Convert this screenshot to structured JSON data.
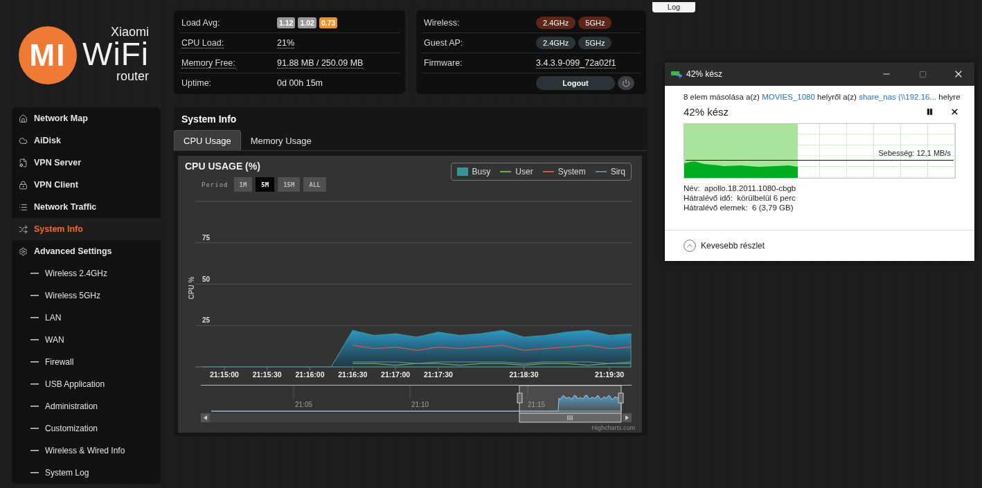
{
  "logo": {
    "mark": "MI",
    "brand": "Xiaomi",
    "product": "WiFi",
    "subtitle": "router"
  },
  "header_button": {
    "label": "Log"
  },
  "status_card": {
    "rows": [
      {
        "label": "Load Avg:",
        "kind": "badges",
        "has_tooltip": false,
        "badges": [
          {
            "text": "1.12",
            "color": "#9a9a9a"
          },
          {
            "text": "1.02",
            "color": "#9a9a9a"
          },
          {
            "text": "0.73",
            "color": "#f0922a"
          }
        ]
      },
      {
        "label": "CPU Load:",
        "kind": "value",
        "has_tooltip": true,
        "value": "21%"
      },
      {
        "label": "Memory Free:",
        "kind": "value",
        "has_tooltip": true,
        "value": "91.88 MB / 250.09 MB"
      },
      {
        "label": "Uptime:",
        "kind": "value",
        "has_tooltip": false,
        "value": "0d 00h 15m"
      }
    ]
  },
  "network_card": {
    "rows": [
      {
        "label": "Wireless:",
        "kind": "toggles",
        "toggles": [
          {
            "text": "2.4GHz",
            "on": true
          },
          {
            "text": "5GHz",
            "on": true
          }
        ]
      },
      {
        "label": "Guest AP:",
        "kind": "toggles",
        "toggles": [
          {
            "text": "2.4GHz",
            "on": false
          },
          {
            "text": "5GHz",
            "on": false
          }
        ]
      },
      {
        "label": "Firmware:",
        "kind": "value",
        "has_tooltip": true,
        "value": "3.4.3.9-099_72a02f1"
      }
    ],
    "logout": {
      "label": "Logout"
    }
  },
  "sidebar": {
    "items": [
      {
        "label": "Network Map",
        "selected": false
      },
      {
        "label": "AiDisk",
        "selected": false
      },
      {
        "label": "VPN Server",
        "selected": false
      },
      {
        "label": "VPN Client",
        "selected": false
      },
      {
        "label": "Network Traffic",
        "selected": false
      },
      {
        "label": "System Info",
        "selected": true
      },
      {
        "label": "Advanced Settings",
        "selected": false,
        "children": [
          {
            "label": "Wireless 2.4GHz",
            "selected": false
          },
          {
            "label": "Wireless 5GHz",
            "selected": false
          },
          {
            "label": "LAN",
            "selected": false
          },
          {
            "label": "WAN",
            "selected": false
          },
          {
            "label": "Firewall",
            "selected": false
          },
          {
            "label": "USB Application",
            "selected": false
          },
          {
            "label": "Administration",
            "selected": false
          },
          {
            "label": "Customization",
            "selected": false
          },
          {
            "label": "Wireless & Wired Info",
            "selected": false
          },
          {
            "label": "System Log",
            "selected": false
          }
        ]
      }
    ]
  },
  "system_info": {
    "title": "System Info",
    "tabs": [
      {
        "label": "CPU Usage",
        "selected": true
      },
      {
        "label": "Memory Usage",
        "selected": false
      }
    ],
    "chart": {
      "period_label": "Period",
      "periods": [
        {
          "label": "1M",
          "selected": false
        },
        {
          "label": "5M",
          "selected": true
        },
        {
          "label": "15M",
          "selected": false
        },
        {
          "label": "ALL",
          "selected": false
        }
      ],
      "navigator_labels": [
        "21:05",
        "21:10",
        "21:15"
      ],
      "credit": "Highcharts.com",
      "chart_data": {
        "type": "area",
        "title": "CPU USAGE (%)",
        "ylabel": "CPU %",
        "categories": [
          null,
          "21:15:00",
          null,
          "21:15:30",
          null,
          "21:16:00",
          null,
          "21:16:30",
          null,
          "21:17:00",
          null,
          "21:17:30",
          null,
          null,
          null,
          "21:18:30",
          null,
          null,
          null,
          "21:19:30",
          null
        ],
        "ylim": [
          0,
          100
        ],
        "yticks": [
          25,
          50,
          75
        ],
        "grid": true,
        "series": [
          {
            "name": "Busy",
            "type": "area",
            "color": "#3a9494",
            "values": [
              0,
              0,
              0,
              0,
              0,
              0,
              0,
              22,
              19,
              20,
              18,
              21,
              19,
              20,
              22,
              18,
              19,
              21,
              22,
              19,
              20
            ]
          },
          {
            "name": "User",
            "type": "line",
            "color": "#6ab04c",
            "values": [
              null,
              null,
              null,
              null,
              null,
              null,
              null,
              2,
              2,
              1,
              2,
              2,
              1,
              2,
              2,
              1,
              2,
              2,
              1,
              2,
              2
            ]
          },
          {
            "name": "System",
            "type": "line",
            "color": "#d9534f",
            "values": [
              null,
              null,
              null,
              null,
              null,
              null,
              null,
              13,
              11,
              12,
              10,
              12,
              11,
              12,
              13,
              10,
              11,
              12,
              13,
              11,
              12
            ]
          },
          {
            "name": "Sirq",
            "type": "line",
            "color": "#6a7f94",
            "values": [
              null,
              null,
              null,
              null,
              null,
              null,
              null,
              3,
              3,
              3,
              2,
              3,
              3,
              3,
              3,
              2,
              3,
              3,
              3,
              2,
              3
            ]
          }
        ]
      }
    }
  },
  "copy_dialog": {
    "title": "42% kész",
    "message": [
      {
        "kind": "text",
        "text": "8 elem másolása a(z)"
      },
      {
        "kind": "link",
        "text": "MOVIES_1080"
      },
      {
        "kind": "text",
        "text": "helyről a(z)"
      },
      {
        "kind": "link",
        "text": "share_nas (\\\\192.16..."
      },
      {
        "kind": "text",
        "text": "helyre"
      }
    ],
    "progress_title": "42% kész",
    "level": 0.42,
    "speed": "Sebesség: 12,1 MB/s",
    "details": [
      {
        "label": "Név:",
        "value": "apollo.18.2011.1080-cbgb"
      },
      {
        "label": "Hátralévő idő:",
        "value": "körülbelül 6 perc"
      },
      {
        "label": "Hátralévő elemek:",
        "value": "6 (3,79 GB)"
      }
    ],
    "toggle": "Kevesebb részlet"
  }
}
